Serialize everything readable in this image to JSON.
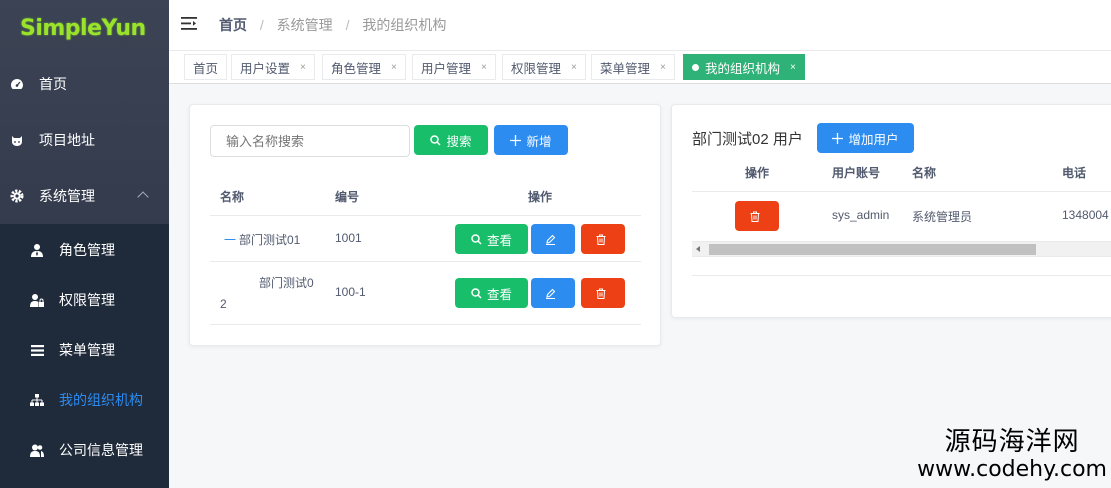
{
  "app": {
    "logo": "SimpleYun"
  },
  "sidebar": {
    "items": [
      {
        "label": "首页",
        "icon": "dashboard-icon"
      },
      {
        "label": "项目地址",
        "icon": "github-icon"
      },
      {
        "label": "系统管理",
        "icon": "gear-icon"
      }
    ],
    "subitems": [
      {
        "label": "角色管理",
        "icon": "user-tie-icon"
      },
      {
        "label": "权限管理",
        "icon": "user-lock-icon"
      },
      {
        "label": "菜单管理",
        "icon": "list-icon"
      },
      {
        "label": "我的组织机构",
        "icon": "sitemap-icon",
        "active": true
      },
      {
        "label": "公司信息管理",
        "icon": "users-icon"
      }
    ]
  },
  "header": {
    "breadcrumb": [
      "首页",
      "系统管理",
      "我的组织机构"
    ],
    "separator": "/"
  },
  "tabs": [
    {
      "label": "首页"
    },
    {
      "label": "用户设置",
      "close": "×"
    },
    {
      "label": "角色管理",
      "close": "×"
    },
    {
      "label": "用户管理",
      "close": "×"
    },
    {
      "label": "权限管理",
      "close": "×"
    },
    {
      "label": "菜单管理",
      "close": "×"
    },
    {
      "label": "我的组织机构",
      "close": "×",
      "active": true
    }
  ],
  "left_panel": {
    "search_placeholder": "输入名称搜索",
    "search_label": "搜索",
    "add_label": "新增",
    "columns": [
      "名称",
      "编号",
      "操作"
    ],
    "rows": [
      {
        "prefix": "一",
        "name": "部门测试01",
        "code": "1001",
        "view_label": "查看"
      },
      {
        "name_line1": "部门测试0",
        "name_line2": "2",
        "code": "100-1",
        "view_label": "查看"
      }
    ]
  },
  "right_panel": {
    "title": "部门测试02 用户",
    "add_user_label": "增加用户",
    "columns": [
      "操作",
      "用户账号",
      "名称",
      "电话"
    ],
    "rows": [
      {
        "account": "sys_admin",
        "name": "系统管理员",
        "phone": "1348004"
      }
    ]
  },
  "watermark": {
    "line1": "源码海洋网",
    "line2": "www.codehy.com"
  },
  "colors": {
    "sidebar": "#2b3244",
    "submenu": "#1f2a3a",
    "active": "#2d8cf0",
    "green": "#19be6b",
    "tab_active": "#2fb277",
    "red": "#ed4014",
    "logo": "#9be32b"
  }
}
